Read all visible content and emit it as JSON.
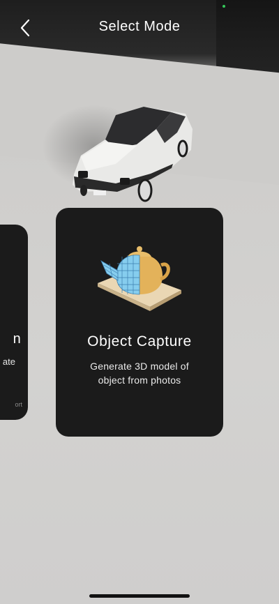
{
  "header": {
    "title": "Select Mode",
    "back_icon": "chevron-left-icon"
  },
  "cards": {
    "left": {
      "title_fragment": "n",
      "desc_fragment": "ate",
      "note_fragment": "ort"
    },
    "main": {
      "title": "Object Capture",
      "description_line1": "Generate 3D model of",
      "description_line2": "object from photos",
      "icon": "teapot-3d-icon"
    }
  },
  "colors": {
    "card_background": "#1b1b1b",
    "text_primary": "#ffffff",
    "teapot_mesh": "#7fc6ea",
    "teapot_solid": "#e3b25a",
    "base_plate": "#ead7b4"
  }
}
